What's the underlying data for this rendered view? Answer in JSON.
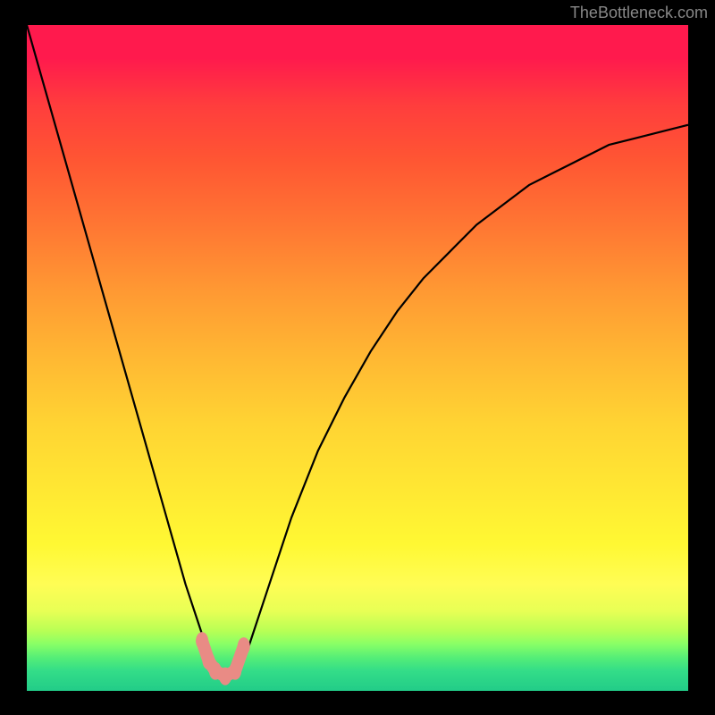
{
  "watermark_text": "TheBottleneck.com",
  "chart_data": {
    "type": "line",
    "title": "",
    "xlabel": "",
    "ylabel": "",
    "x": [
      0.0,
      0.02,
      0.04,
      0.06,
      0.08,
      0.1,
      0.12,
      0.14,
      0.16,
      0.18,
      0.2,
      0.22,
      0.24,
      0.26,
      0.27,
      0.28,
      0.29,
      0.3,
      0.31,
      0.32,
      0.33,
      0.34,
      0.36,
      0.38,
      0.4,
      0.44,
      0.48,
      0.52,
      0.56,
      0.6,
      0.64,
      0.68,
      0.72,
      0.76,
      0.8,
      0.84,
      0.88,
      0.92,
      0.96,
      1.0
    ],
    "y": [
      1.0,
      0.93,
      0.86,
      0.79,
      0.72,
      0.65,
      0.58,
      0.51,
      0.44,
      0.37,
      0.3,
      0.23,
      0.16,
      0.1,
      0.07,
      0.05,
      0.03,
      0.02,
      0.02,
      0.03,
      0.05,
      0.08,
      0.14,
      0.2,
      0.26,
      0.36,
      0.44,
      0.51,
      0.57,
      0.62,
      0.66,
      0.7,
      0.73,
      0.76,
      0.78,
      0.8,
      0.82,
      0.83,
      0.84,
      0.85
    ],
    "ylim": [
      0,
      1
    ],
    "xlim": [
      0,
      1
    ],
    "background": "rainbow-gradient-black-border",
    "markers": {
      "x": [
        0.265,
        0.275,
        0.285,
        0.3,
        0.315,
        0.328
      ],
      "y": [
        0.075,
        0.045,
        0.03,
        0.022,
        0.03,
        0.067
      ],
      "color": "#e98b85"
    },
    "annotations": []
  }
}
